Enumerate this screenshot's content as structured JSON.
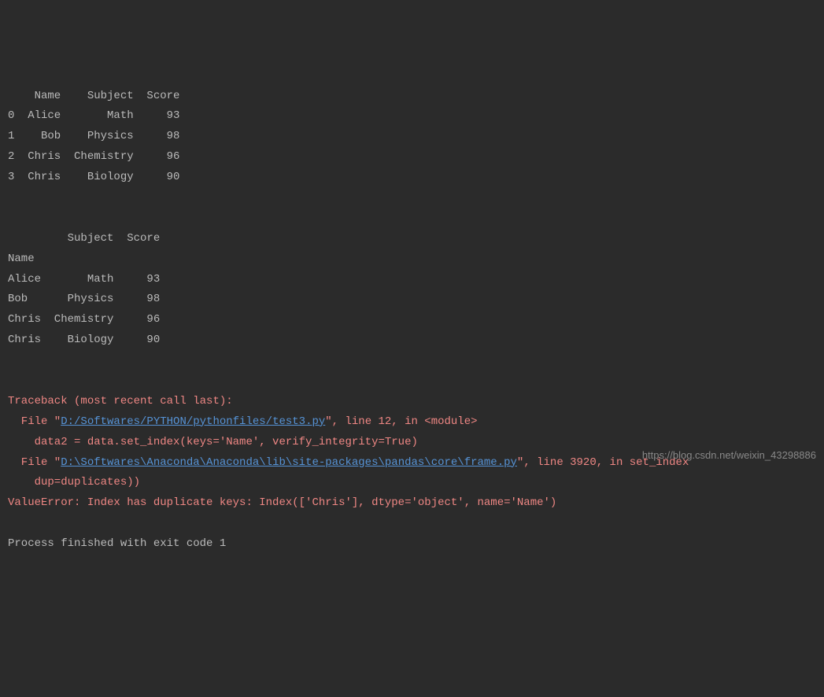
{
  "table1": {
    "header": "    Name    Subject  Score",
    "rows": [
      "0  Alice       Math     93",
      "1    Bob    Physics     98",
      "2  Chris  Chemistry     96",
      "3  Chris    Biology     90"
    ]
  },
  "table2": {
    "header": "         Subject  Score",
    "index_label": "Name",
    "rows": [
      "Alice       Math     93",
      "Bob      Physics     98",
      "Chris  Chemistry     96",
      "Chris    Biology     90"
    ]
  },
  "traceback": {
    "header": "Traceback (most recent call last):",
    "line1_prefix": "  File \"",
    "line1_link": "D:/Softwares/PYTHON/pythonfiles/test3.py",
    "line1_suffix": "\", line 12, in <module>",
    "line2": "    data2 = data.set_index(keys='Name', verify_integrity=True)",
    "line3_prefix": "  File \"",
    "line3_link": "D:\\Softwares\\Anaconda\\Anaconda\\lib\\site-packages\\pandas\\core\\frame.py",
    "line3_suffix": "\", line 3920, in set_index",
    "line4": "    dup=duplicates))",
    "error": "ValueError: Index has duplicate keys: Index(['Chris'], dtype='object', name='Name')"
  },
  "exit_message": "Process finished with exit code 1",
  "watermark": "https://blog.csdn.net/weixin_43298886"
}
